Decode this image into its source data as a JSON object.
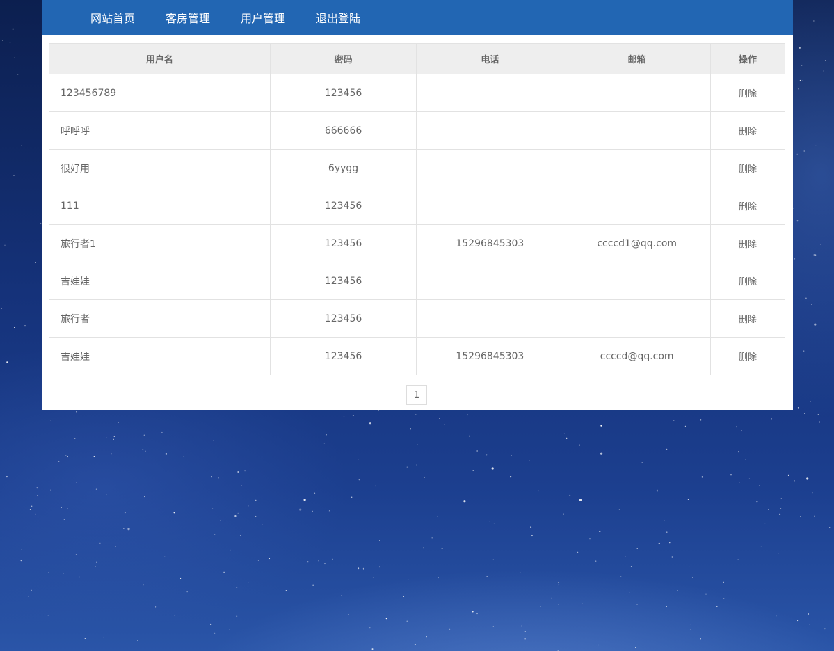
{
  "nav": {
    "items": [
      {
        "label": "网站首页"
      },
      {
        "label": "客房管理"
      },
      {
        "label": "用户管理"
      },
      {
        "label": "退出登陆"
      }
    ]
  },
  "table": {
    "headers": {
      "username": "用户名",
      "password": "密码",
      "phone": "电话",
      "email": "邮箱",
      "action": "操作"
    },
    "rows": [
      {
        "username": "123456789",
        "password": "123456",
        "phone": "",
        "email": "",
        "action": "删除"
      },
      {
        "username": "呼呼呼",
        "password": "666666",
        "phone": "",
        "email": "",
        "action": "删除"
      },
      {
        "username": "很好用",
        "password": "6yygg",
        "phone": "",
        "email": "",
        "action": "删除"
      },
      {
        "username": "111",
        "password": "123456",
        "phone": "",
        "email": "",
        "action": "删除"
      },
      {
        "username": "旅行者1",
        "password": "123456",
        "phone": "15296845303",
        "email": "ccccd1@qq.com",
        "action": "删除"
      },
      {
        "username": "吉娃娃",
        "password": "123456",
        "phone": "",
        "email": "",
        "action": "删除"
      },
      {
        "username": "旅行者",
        "password": "123456",
        "phone": "",
        "email": "",
        "action": "删除"
      },
      {
        "username": "吉娃娃",
        "password": "123456",
        "phone": "15296845303",
        "email": "ccccd@qq.com",
        "action": "删除"
      }
    ]
  },
  "pagination": {
    "current_page": "1"
  },
  "colors": {
    "navbar": "#2266b3",
    "header_bg": "#eeeeee",
    "border": "#e2e2e2",
    "text": "#666666"
  }
}
